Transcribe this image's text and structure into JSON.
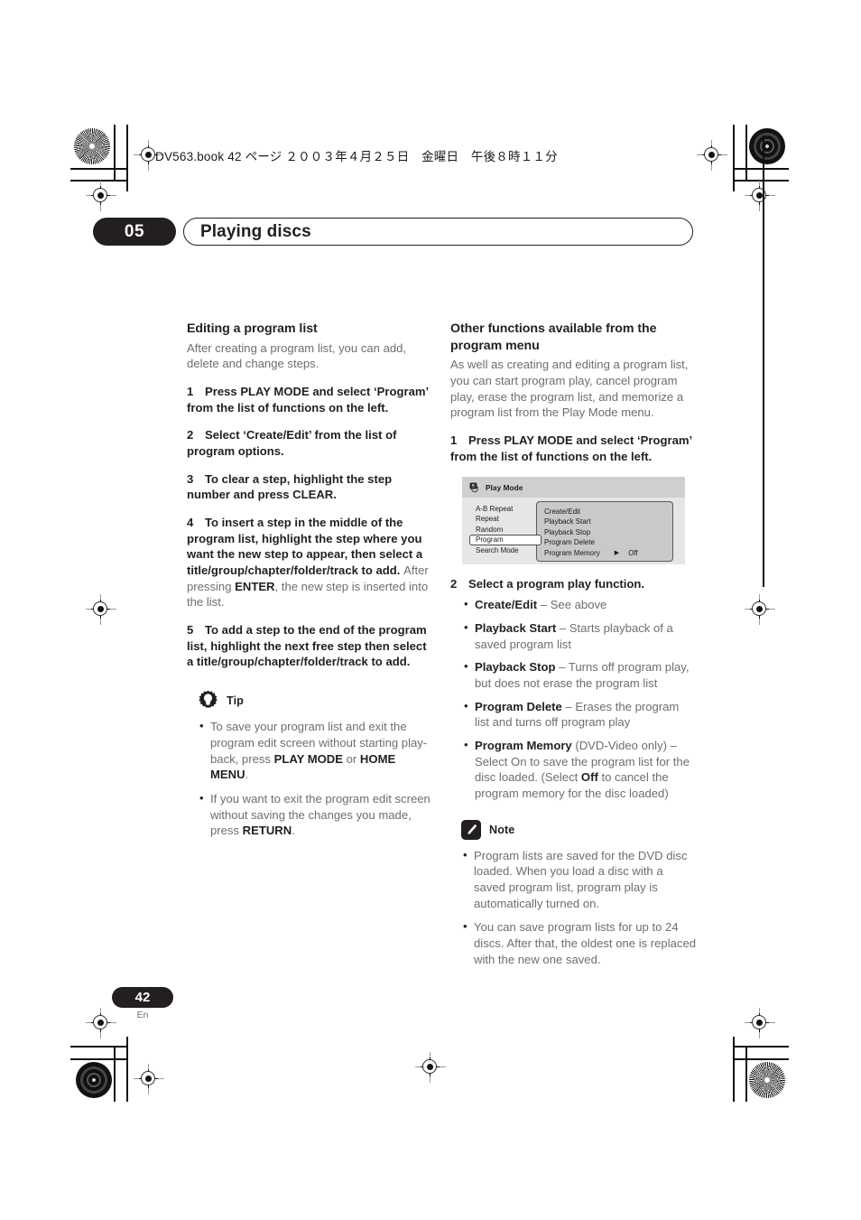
{
  "print_marks": {
    "book_header": "DV563.book  42 ページ  ２００３年４月２５日　金曜日　午後８時１１分"
  },
  "chapter": {
    "number": "05",
    "title": "Playing discs"
  },
  "left_column": {
    "heading": "Editing a program list",
    "intro": "After creating a program list, you can add, delete and change steps.",
    "steps": [
      {
        "n": "1",
        "text": "Press PLAY MODE and select ‘Program’ from the list of functions on the left."
      },
      {
        "n": "2",
        "text": "Select ‘Create/Edit’ from the list of program options."
      },
      {
        "n": "3",
        "text": "To clear a step, highlight the step number and press CLEAR."
      },
      {
        "n": "4",
        "text": "To insert a step in the middle of the program list, highlight the step where you want the new step to appear, then select a title/group/chapter/folder/track to add."
      },
      {
        "n": "5",
        "text": "To add a step to the end of the program list, highlight the next free step then select a title/group/chapter/folder/track to add."
      }
    ],
    "step4_after_lead": "After pressing ",
    "step4_after_bold": "ENTER",
    "step4_after_tail": ", the new step is inserted into the list.",
    "tip": {
      "icon": "gear-lightbulb-icon",
      "label": "Tip",
      "items": [
        {
          "lead": "To save your program list and exit the program edit screen without starting play-back, press ",
          "bold1": "PLAY MODE",
          "mid": " or ",
          "bold2": "HOME MENU",
          "tail": "."
        },
        {
          "lead": "If you want to exit the program edit screen without saving the changes you made, press ",
          "bold1": "RETURN",
          "mid": "",
          "bold2": "",
          "tail": "."
        }
      ]
    }
  },
  "right_column": {
    "heading": "Other functions available from the program menu",
    "intro": "As well as creating and editing a program list, you can start program play, cancel program play, erase the program list, and memorize a program list from the Play Mode menu.",
    "step1": {
      "n": "1",
      "text": "Press PLAY MODE and select ‘Program’ from the list of functions on the left."
    },
    "osd": {
      "icon": "play-mode-icon",
      "title": "Play Mode",
      "left_menu": [
        {
          "label": "A-B Repeat",
          "selected": false
        },
        {
          "label": "Repeat",
          "selected": false
        },
        {
          "label": "Random",
          "selected": false
        },
        {
          "label": "Program",
          "selected": true
        },
        {
          "label": "Search Mode",
          "selected": false
        }
      ],
      "options": [
        {
          "label": "Create/Edit",
          "value": ""
        },
        {
          "label": "Playback Start",
          "value": ""
        },
        {
          "label": "Playback Stop",
          "value": ""
        },
        {
          "label": "Program Delete",
          "value": ""
        },
        {
          "label": "Program Memory",
          "value": "Off",
          "arrow": "▶"
        }
      ]
    },
    "step2": {
      "n": "2",
      "text": "Select a program play function."
    },
    "functions": [
      {
        "name": "Create/Edit",
        "desc": " – See above"
      },
      {
        "name": "Playback Start",
        "desc": " – Starts playback of a saved program list"
      },
      {
        "name": "Playback Stop",
        "desc": " – Turns off program play, but does not erase the program list"
      },
      {
        "name": "Program Delete",
        "desc": " – Erases the program list and turns off program play"
      },
      {
        "name": "Program Memory",
        "desc_pre": " (DVD-Video only) – Select On to save the program list for the disc loaded. (Select ",
        "desc_bold": "Off",
        "desc_post": " to cancel the program memory for the disc loaded)"
      }
    ],
    "note": {
      "icon": "pencil-note-icon",
      "label": "Note",
      "items": [
        "Program lists are saved for the DVD disc loaded. When you load a disc with a saved program list, program play is automatically turned on.",
        "You can save program lists for up to 24 discs. After that, the oldest one is replaced with the new one saved."
      ]
    }
  },
  "footer": {
    "page_number": "42",
    "language": "En"
  },
  "colors": {
    "ink": "#231f20",
    "body_gray": "#6d6e71",
    "osd_bg": "#cfcfcf",
    "osd_panel": "#c9c9c9"
  }
}
